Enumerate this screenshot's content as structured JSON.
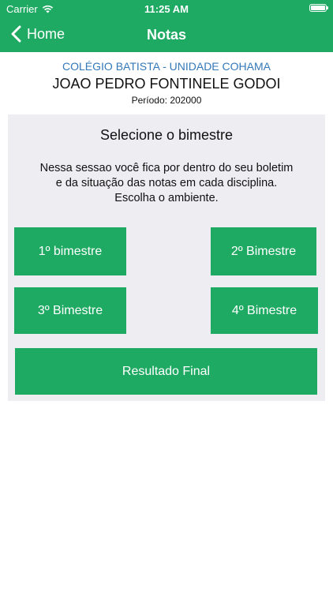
{
  "status_bar": {
    "carrier": "Carrier",
    "time": "11:25 AM",
    "wifi_icon": "wifi-icon",
    "battery_icon": "battery-icon"
  },
  "nav": {
    "back_label": "Home",
    "back_icon": "chevron-left-icon",
    "title": "Notas"
  },
  "header": {
    "school": "COLÉGIO BATISTA - UNIDADE COHAMA",
    "student_name": "JOAO PEDRO FONTINELE GODOI",
    "period": "Período: 202000"
  },
  "card": {
    "title": "Selecione o bimestre",
    "description": "Nessa sessao você fica por dentro do seu boletim e da situação das notas em cada disciplina. Escolha o ambiente.",
    "buttons": [
      {
        "label": "1º bimestre"
      },
      {
        "label": "2º Bimestre"
      },
      {
        "label": "3º Bimestre"
      },
      {
        "label": "4º Bimestre"
      }
    ],
    "final_button": "Resultado Final"
  },
  "colors": {
    "primary": "#1faa63",
    "school_text": "#3478b8",
    "card_background": "#ededf2"
  }
}
